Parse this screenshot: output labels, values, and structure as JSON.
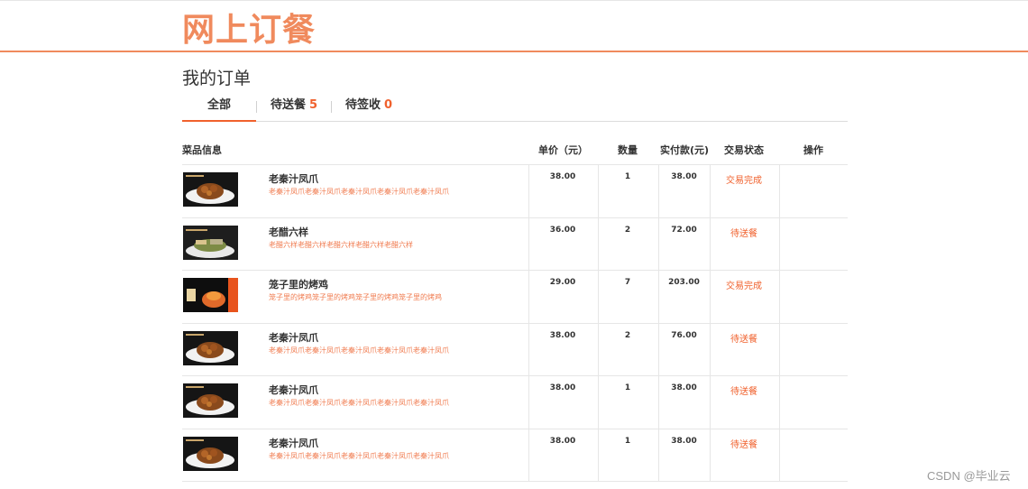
{
  "header": {
    "logo": "网上订餐"
  },
  "page": {
    "title": "我的订单"
  },
  "tabs": [
    {
      "label": "全部",
      "count": ""
    },
    {
      "label": "待送餐",
      "count": "5"
    },
    {
      "label": "待签收",
      "count": "0"
    }
  ],
  "table": {
    "headers": {
      "dish_info": "菜品信息",
      "unit_price": "单价（元）",
      "quantity": "数量",
      "paid": "实付款(元)",
      "status": "交易状态",
      "action": "操作"
    },
    "rows": [
      {
        "name": "老秦汁凤爪",
        "desc": "老秦汁凤爪老秦汁凤爪老秦汁凤爪老秦汁凤爪老秦汁凤爪",
        "price": "38.00",
        "qty": "1",
        "paid": "38.00",
        "status": "交易完成"
      },
      {
        "name": "老醋六样",
        "desc": "老醋六样老醋六样老醋六样老醋六样老醋六样",
        "price": "36.00",
        "qty": "2",
        "paid": "72.00",
        "status": "待送餐"
      },
      {
        "name": "笼子里的烤鸡",
        "desc": "笼子里的烤鸡笼子里的烤鸡笼子里的烤鸡笼子里的烤鸡",
        "price": "29.00",
        "qty": "7",
        "paid": "203.00",
        "status": "交易完成"
      },
      {
        "name": "老秦汁凤爪",
        "desc": "老秦汁凤爪老秦汁凤爪老秦汁凤爪老秦汁凤爪老秦汁凤爪",
        "price": "38.00",
        "qty": "2",
        "paid": "76.00",
        "status": "待送餐"
      },
      {
        "name": "老秦汁凤爪",
        "desc": "老秦汁凤爪老秦汁凤爪老秦汁凤爪老秦汁凤爪老秦汁凤爪",
        "price": "38.00",
        "qty": "1",
        "paid": "38.00",
        "status": "待送餐"
      },
      {
        "name": "老秦汁凤爪",
        "desc": "老秦汁凤爪老秦汁凤爪老秦汁凤爪老秦汁凤爪老秦汁凤爪",
        "price": "38.00",
        "qty": "1",
        "paid": "38.00",
        "status": "待送餐"
      }
    ]
  },
  "watermark": "CSDN @毕业云",
  "colors": {
    "accent": "#f0612d",
    "logo": "#f08a5d"
  }
}
